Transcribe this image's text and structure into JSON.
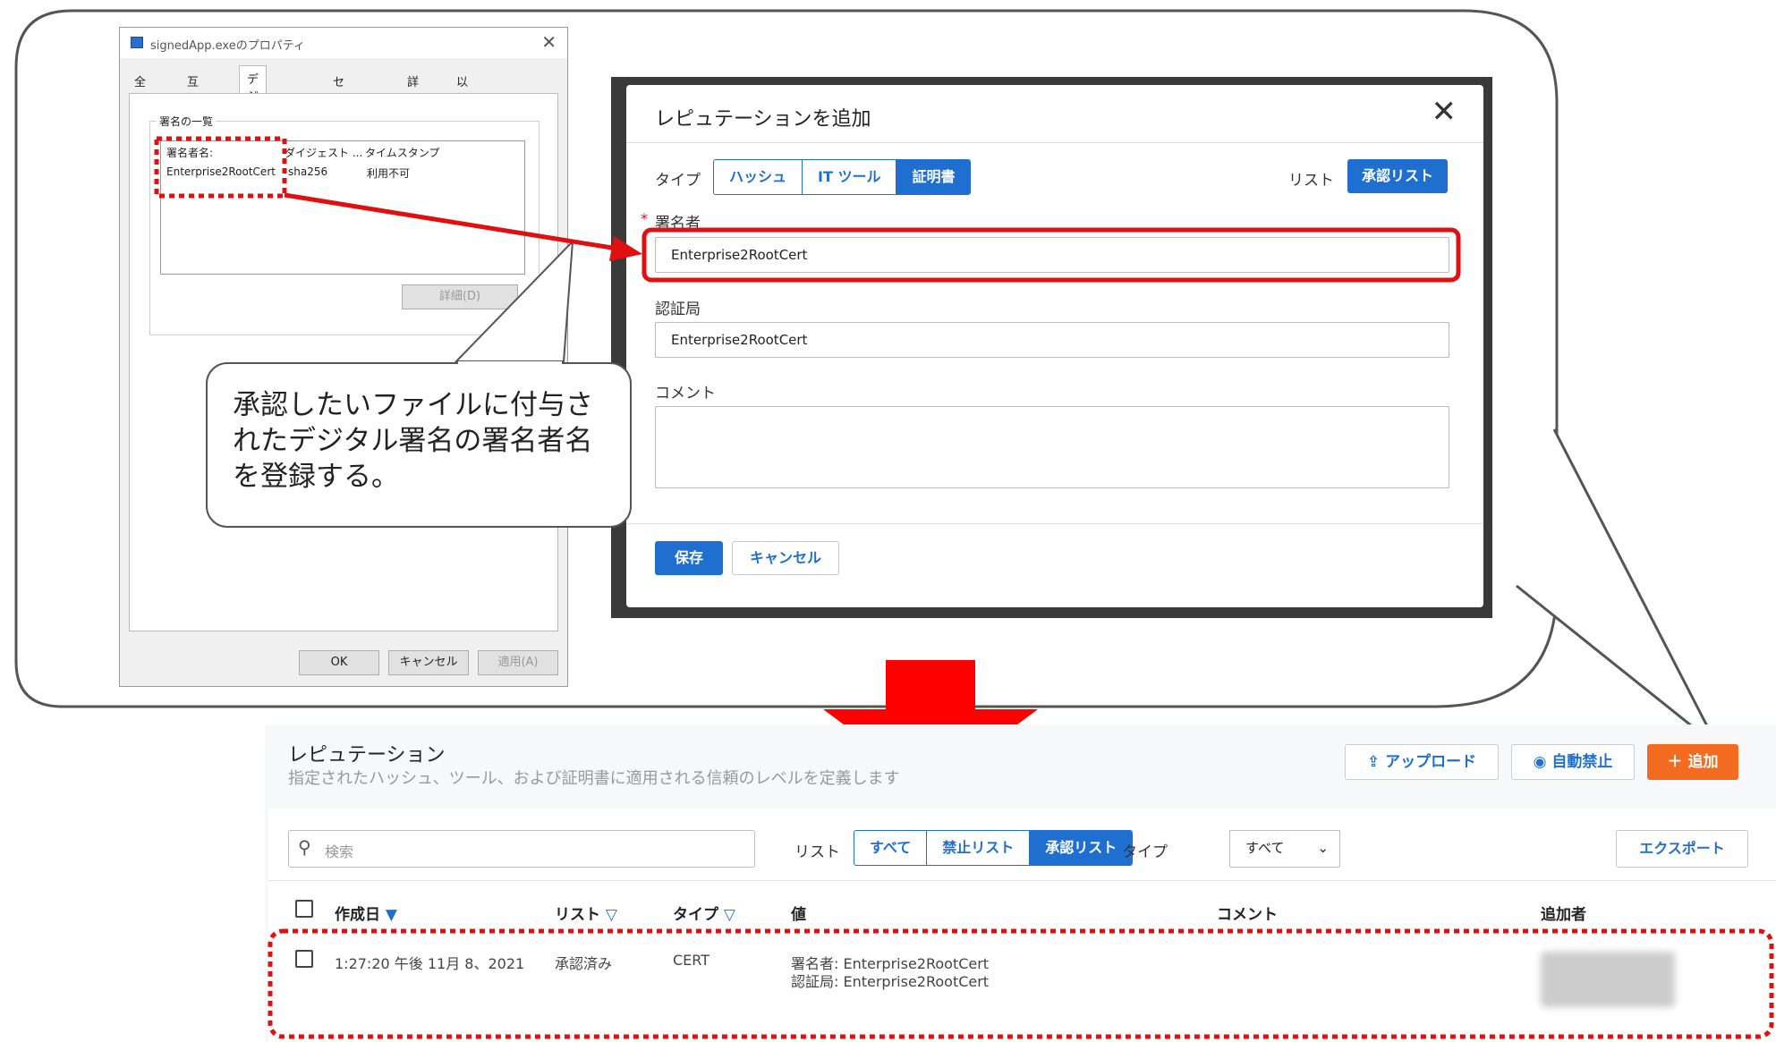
{
  "properties_dialog": {
    "title": "signedApp.exeのプロパティ",
    "tabs": [
      "全般",
      "互換性",
      "デジタル署名",
      "セキュリティ",
      "詳細",
      "以前のバージョン"
    ],
    "group_title": "署名の一覧",
    "columns": [
      "署名者名:",
      "ダイジェスト ...",
      "タイムスタンプ"
    ],
    "row": {
      "signer": "Enterprise2RootCert",
      "digest": "sha256",
      "timestamp": "利用不可"
    },
    "details_button": "詳細(D)",
    "ok_button": "OK",
    "cancel_button": "キャンセル",
    "apply_button": "適用(A)"
  },
  "note_text": "承認したいファイルに付与されたデジタル署名の署名者名を登録する。",
  "modal": {
    "title": "レピュテーションを追加",
    "type_label": "タイプ",
    "type_options": [
      "ハッシュ",
      "IT ツール",
      "証明書"
    ],
    "type_selected": "証明書",
    "list_label": "リスト",
    "list_value": "承認リスト",
    "required_mark": "*",
    "signer_label": "署名者",
    "signer_value": "Enterprise2RootCert",
    "ca_label": "認証局",
    "ca_value": "Enterprise2RootCert",
    "comment_label": "コメント",
    "comment_value": "",
    "save_button": "保存",
    "cancel_button": "キャンセル"
  },
  "reputation_page": {
    "title": "レピュテーション",
    "subtitle": "指定されたハッシュ、ツール、および証明書に適用される信頼のレベルを定義します",
    "upload_button": "アップロード",
    "auto_ban_button": "自動禁止",
    "add_button": "追加",
    "search_placeholder": "検索",
    "list_label": "リスト",
    "list_filters": [
      "すべて",
      "禁止リスト",
      "承認リスト"
    ],
    "list_selected": "承認リスト",
    "type_label": "タイプ",
    "type_select": "すべて",
    "export_button": "エクスポート",
    "columns": [
      "作成日",
      "リスト",
      "タイプ",
      "値",
      "コメント",
      "追加者"
    ],
    "row": {
      "created": "1:27:20 午後 11月 8、2021",
      "list": "承認済み",
      "type": "CERT",
      "value_line1": "署名者: Enterprise2RootCert",
      "value_line2": "認証局: Enterprise2RootCert",
      "comment": ""
    }
  },
  "colors": {
    "accent_blue": "#1f6fd1",
    "highlight_red": "#e01010",
    "add_orange": "#f26b21"
  }
}
